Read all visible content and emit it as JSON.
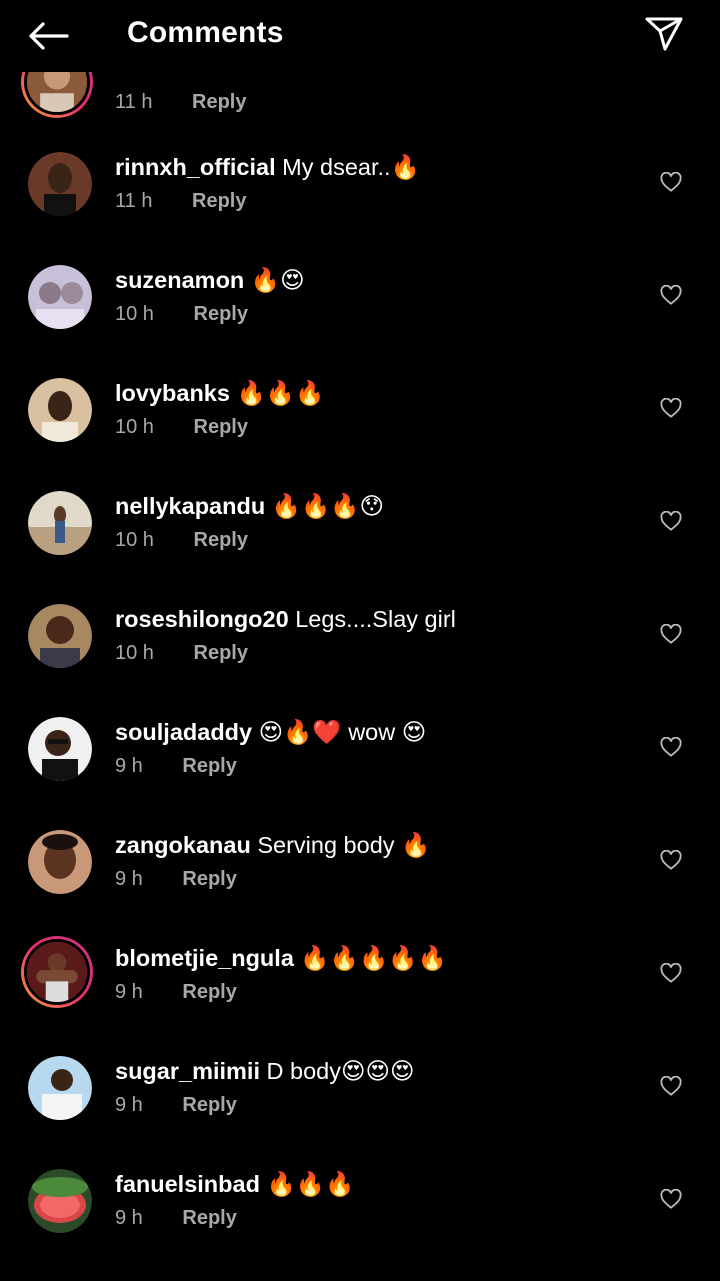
{
  "header": {
    "title": "Comments",
    "back_icon": "arrow-left-icon",
    "send_icon": "send-icon"
  },
  "comments": [
    {
      "username": "",
      "text": "",
      "time": "11 h",
      "reply": "Reply",
      "story": true,
      "avatar_color": "#8a5a3a"
    },
    {
      "username": "rinnxh_official",
      "text": "My dsear..🔥",
      "time": "11 h",
      "reply": "Reply",
      "story": false,
      "avatar_color": "#3a1e12"
    },
    {
      "username": "suzenamon",
      "text": "🔥😍",
      "time": "10 h",
      "reply": "Reply",
      "story": false,
      "avatar_color": "#b8a8c8"
    },
    {
      "username": "lovybanks",
      "text": "🔥🔥🔥",
      "time": "10 h",
      "reply": "Reply",
      "story": false,
      "avatar_color": "#c8b088"
    },
    {
      "username": "nellykapandu",
      "text": "🔥🔥🔥😯",
      "time": "10 h",
      "reply": "Reply",
      "story": false,
      "avatar_color": "#d8d0c0"
    },
    {
      "username": "roseshilongo20",
      "text": "Legs....Slay girl",
      "time": "10 h",
      "reply": "Reply",
      "story": false,
      "avatar_color": "#6a4a38"
    },
    {
      "username": "souljadaddy",
      "text": "😍🔥❤️ wow 😍",
      "time": "9 h",
      "reply": "Reply",
      "story": false,
      "avatar_color": "#e8e8e8"
    },
    {
      "username": "zangokanau",
      "text": "Serving body 🔥",
      "time": "9 h",
      "reply": "Reply",
      "story": false,
      "avatar_color": "#8a6a4a"
    },
    {
      "username": "blometjie_ngula",
      "text": "🔥🔥🔥🔥🔥",
      "time": "9 h",
      "reply": "Reply",
      "story": true,
      "avatar_color": "#7a2a2a"
    },
    {
      "username": "sugar_miimii",
      "text": "D body😍😍😍",
      "time": "9 h",
      "reply": "Reply",
      "story": false,
      "avatar_color": "#a8c8e0"
    },
    {
      "username": "fanuelsinbad",
      "text": "🔥🔥🔥",
      "time": "9 h",
      "reply": "Reply",
      "story": false,
      "avatar_color": "#3a7a3a"
    }
  ]
}
